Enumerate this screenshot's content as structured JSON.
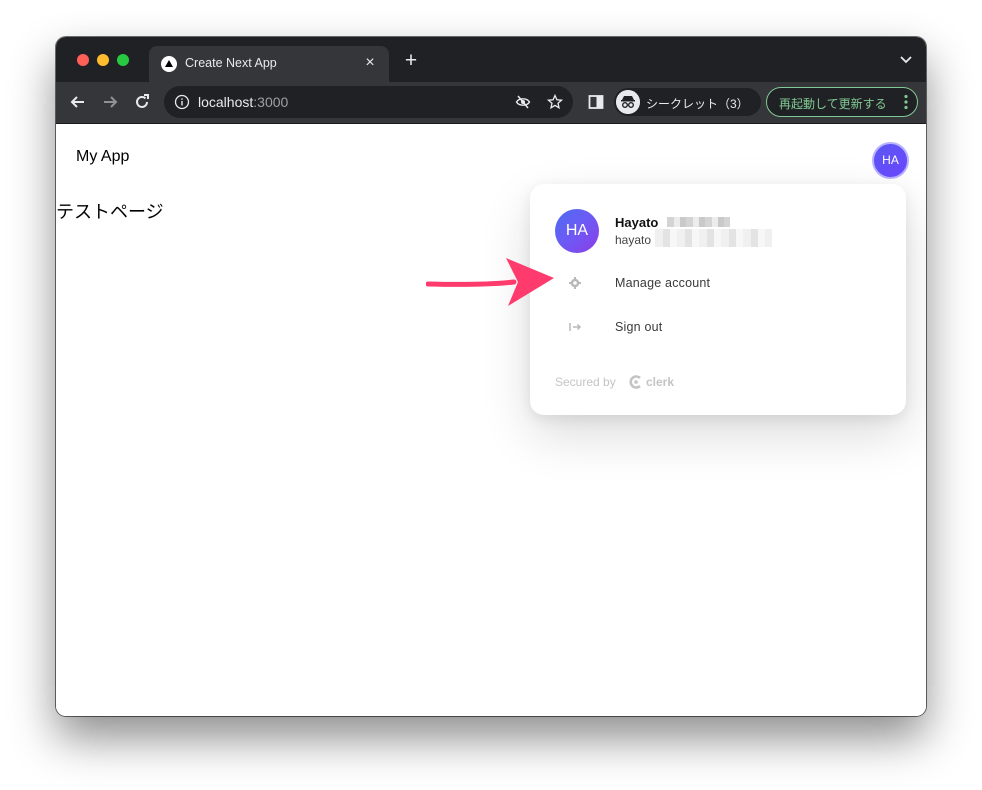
{
  "browser": {
    "tab": {
      "title": "Create Next App",
      "close_icon": "×"
    },
    "new_tab_icon": "+",
    "url": {
      "host": "localhost",
      "port": ":3000"
    },
    "incognito_label": "シークレット（3）",
    "update_button_label": "再起動して更新する"
  },
  "page": {
    "brand": "My App",
    "heading": "テストページ",
    "user_button_initials": "HA"
  },
  "user_menu": {
    "avatar_initials": "HA",
    "name": "Hayato",
    "email": "hayato",
    "items": [
      {
        "label": "Manage account",
        "icon": "gear-icon"
      },
      {
        "label": "Sign out",
        "icon": "sign-out-icon"
      }
    ],
    "secured_by": "Secured by",
    "provider": "clerk"
  },
  "colors": {
    "annotation_arrow": "#ff3b6e",
    "clerk_accent": "#6c47ff",
    "update_green": "#81c995"
  }
}
